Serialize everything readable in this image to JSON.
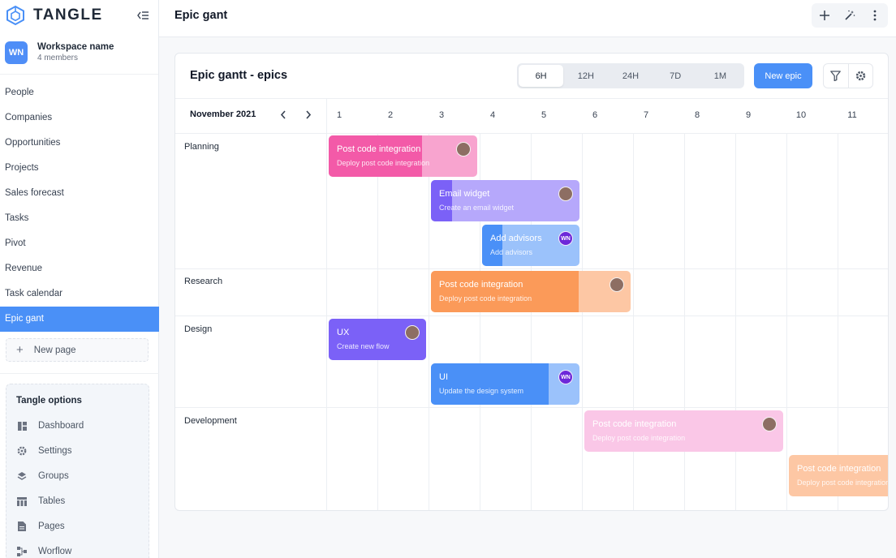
{
  "app": {
    "brand": "TANGLE"
  },
  "workspace": {
    "initials": "WN",
    "name": "Workspace name",
    "members": "4 members"
  },
  "sidebar": {
    "items": [
      {
        "label": "People"
      },
      {
        "label": "Companies"
      },
      {
        "label": "Opportunities"
      },
      {
        "label": "Projects"
      },
      {
        "label": "Sales forecast"
      },
      {
        "label": "Tasks"
      },
      {
        "label": "Pivot"
      },
      {
        "label": "Revenue"
      },
      {
        "label": "Task calendar"
      },
      {
        "label": "Epic gant",
        "active": true
      }
    ],
    "new_page": "New page",
    "options_title": "Tangle options",
    "options": [
      {
        "label": "Dashboard",
        "icon": "dashboard-icon"
      },
      {
        "label": "Settings",
        "icon": "gear-icon"
      },
      {
        "label": "Groups",
        "icon": "layers-icon"
      },
      {
        "label": "Tables",
        "icon": "table-icon"
      },
      {
        "label": "Pages",
        "icon": "page-icon"
      },
      {
        "label": "Worflow",
        "icon": "workflow-icon"
      }
    ]
  },
  "header": {
    "title": "Epic gant"
  },
  "gantt": {
    "title": "Epic gantt - epics",
    "zoom_options": [
      "6H",
      "12H",
      "24H",
      "7D",
      "1M"
    ],
    "zoom_selected": "6H",
    "new_epic_label": "New epic",
    "month": "November 2021",
    "days": [
      "1",
      "2",
      "3",
      "4",
      "5",
      "6",
      "7",
      "8",
      "9",
      "10",
      "11"
    ],
    "groups": [
      {
        "name": "Planning"
      },
      {
        "name": "Research"
      },
      {
        "name": "Design"
      },
      {
        "name": "Development"
      }
    ],
    "epics": [
      {
        "title": "Post code integration",
        "subtitle": "Deploy post code integration",
        "group": "Planning",
        "color": "#f35aa8",
        "progress": 0.63,
        "assignee": "photo"
      },
      {
        "title": "Email widget",
        "subtitle": "Create an email widget",
        "group": "Planning",
        "color": "#7b61f7",
        "progress": 0.14,
        "assignee": "photo"
      },
      {
        "title": "Add advisors",
        "subtitle": "Add advisors",
        "group": "Planning",
        "color": "#4a90f7",
        "progress": 0.21,
        "assignee": "WN"
      },
      {
        "title": "Post code integration",
        "subtitle": "Deploy post code integration",
        "group": "Research",
        "color": "#fb9a59",
        "progress": 0.74,
        "assignee": "photo"
      },
      {
        "title": "UX",
        "subtitle": "Create new flow",
        "group": "Design",
        "color": "#7b61f7",
        "progress": 1.0,
        "assignee": "photo"
      },
      {
        "title": "UI",
        "subtitle": "Update the design system",
        "group": "Design",
        "color": "#4a90f7",
        "progress": 0.79,
        "assignee": "WN"
      },
      {
        "title": "Post code integration",
        "subtitle": "Deploy post code integration",
        "group": "Development",
        "color": "#f59ad3",
        "progress": 0.0,
        "assignee": "photo"
      },
      {
        "title": "Post code integration",
        "subtitle": "Deploy post code integration",
        "group": "Development",
        "color": "#fb9a59",
        "progress": 0.0,
        "assignee": null
      }
    ]
  },
  "colors": {
    "accent": "#4a90f7",
    "sidebar_active": "#4a90f7"
  }
}
